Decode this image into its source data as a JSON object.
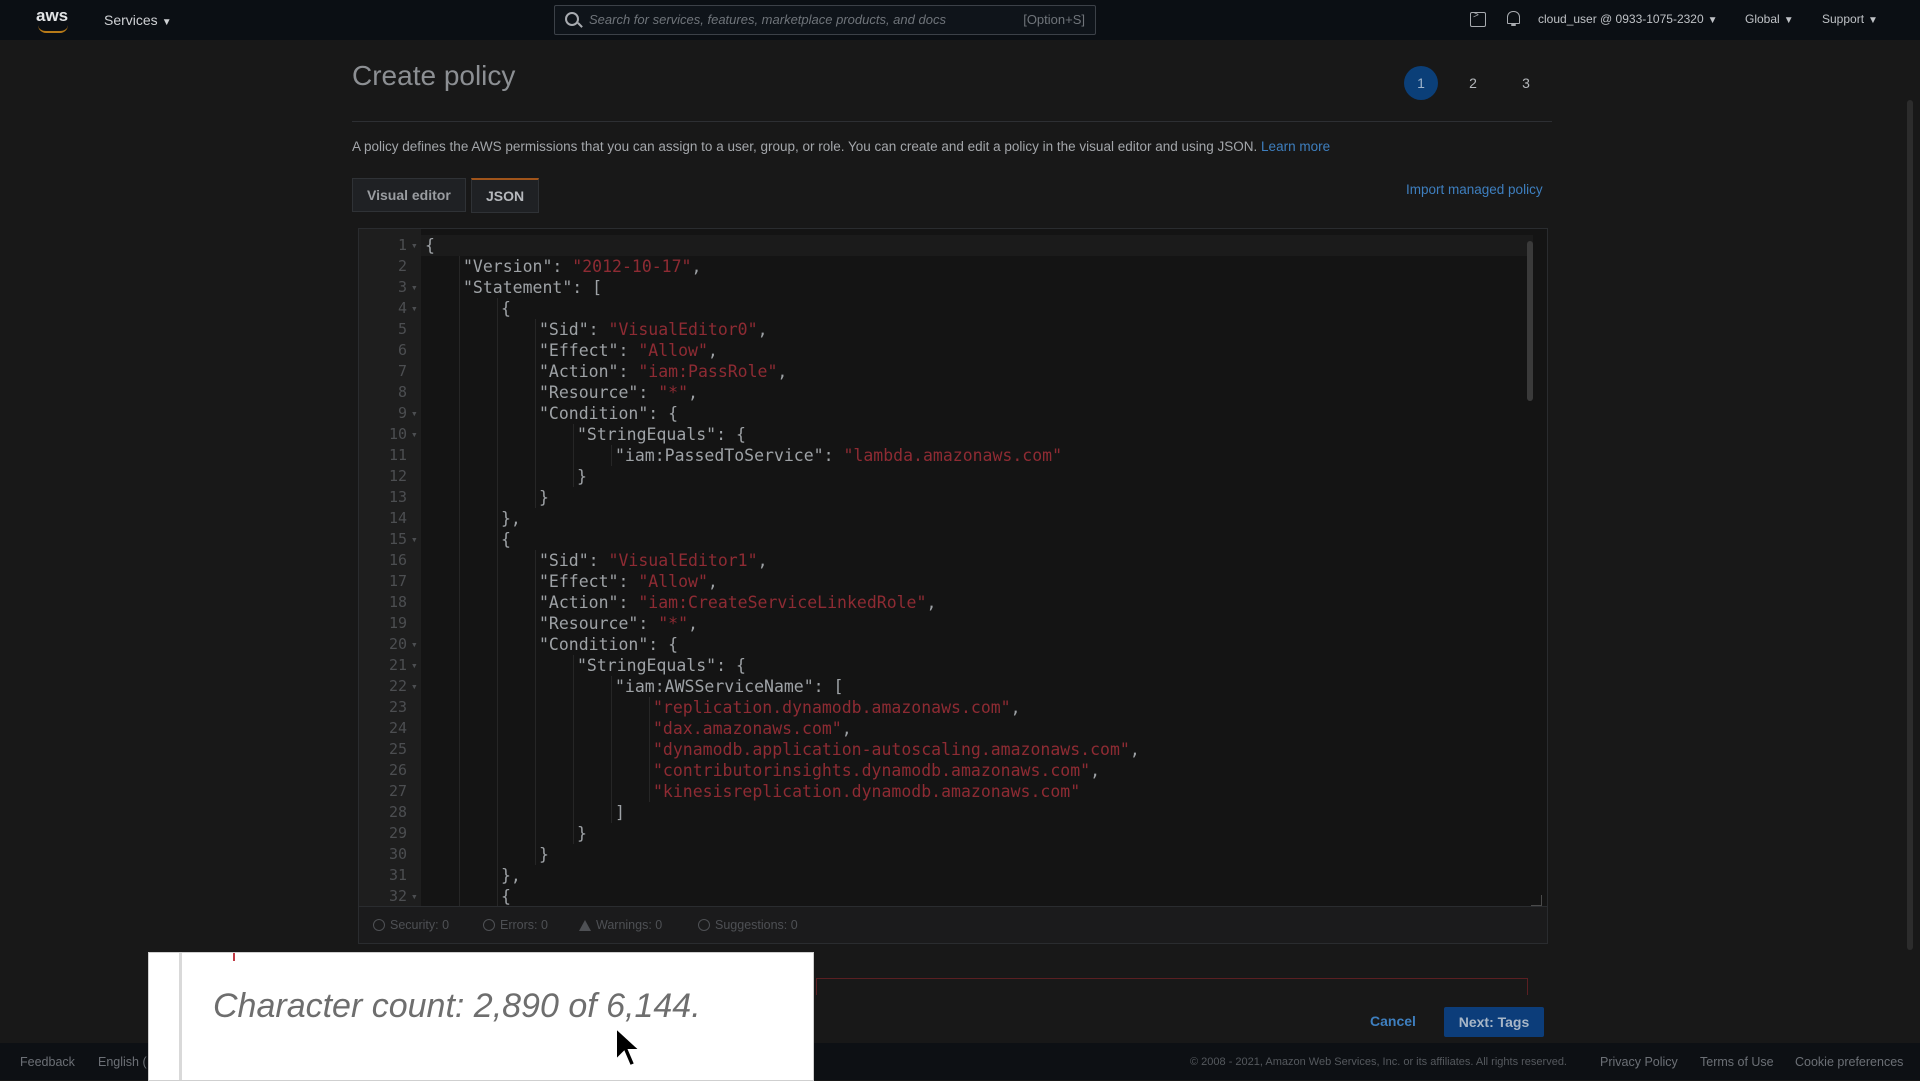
{
  "topnav": {
    "logo": "aws",
    "services_label": "Services",
    "search_placeholder": "Search for services, features, marketplace products, and docs",
    "search_shortcut": "[Option+S]",
    "account": "cloud_user @ 0933-1075-2320",
    "region": "Global",
    "support": "Support"
  },
  "page": {
    "title": "Create policy",
    "steps": [
      "1",
      "2",
      "3"
    ],
    "description": "A policy defines the AWS permissions that you can assign to a user, group, or role. You can create and edit a policy in the visual editor and using JSON.",
    "learn_more": "Learn more",
    "tabs": [
      "Visual editor",
      "JSON"
    ],
    "active_tab": "JSON",
    "import_link": "Import managed policy"
  },
  "editor": {
    "lines": [
      {
        "n": "1",
        "fold": true,
        "indent": 0,
        "parts": [
          [
            "p",
            "{"
          ]
        ]
      },
      {
        "n": "2",
        "fold": false,
        "indent": 1,
        "parts": [
          [
            "p",
            "\"Version\": "
          ],
          [
            "s",
            "\"2012-10-17\""
          ],
          [
            "p",
            ","
          ]
        ]
      },
      {
        "n": "3",
        "fold": true,
        "indent": 1,
        "parts": [
          [
            "p",
            "\"Statement\": ["
          ]
        ]
      },
      {
        "n": "4",
        "fold": true,
        "indent": 2,
        "parts": [
          [
            "p",
            "{"
          ]
        ]
      },
      {
        "n": "5",
        "fold": false,
        "indent": 3,
        "parts": [
          [
            "p",
            "\"Sid\": "
          ],
          [
            "s",
            "\"VisualEditor0\""
          ],
          [
            "p",
            ","
          ]
        ]
      },
      {
        "n": "6",
        "fold": false,
        "indent": 3,
        "parts": [
          [
            "p",
            "\"Effect\": "
          ],
          [
            "s",
            "\"Allow\""
          ],
          [
            "p",
            ","
          ]
        ]
      },
      {
        "n": "7",
        "fold": false,
        "indent": 3,
        "parts": [
          [
            "p",
            "\"Action\": "
          ],
          [
            "s",
            "\"iam:PassRole\""
          ],
          [
            "p",
            ","
          ]
        ]
      },
      {
        "n": "8",
        "fold": false,
        "indent": 3,
        "parts": [
          [
            "p",
            "\"Resource\": "
          ],
          [
            "s",
            "\"*\""
          ],
          [
            "p",
            ","
          ]
        ]
      },
      {
        "n": "9",
        "fold": true,
        "indent": 3,
        "parts": [
          [
            "p",
            "\"Condition\": {"
          ]
        ]
      },
      {
        "n": "10",
        "fold": true,
        "indent": 4,
        "parts": [
          [
            "p",
            "\"StringEquals\": {"
          ]
        ]
      },
      {
        "n": "11",
        "fold": false,
        "indent": 5,
        "parts": [
          [
            "p",
            "\"iam:PassedToService\": "
          ],
          [
            "s",
            "\"lambda.amazonaws.com\""
          ]
        ]
      },
      {
        "n": "12",
        "fold": false,
        "indent": 4,
        "parts": [
          [
            "p",
            "}"
          ]
        ]
      },
      {
        "n": "13",
        "fold": false,
        "indent": 3,
        "parts": [
          [
            "p",
            "}"
          ]
        ]
      },
      {
        "n": "14",
        "fold": false,
        "indent": 2,
        "parts": [
          [
            "p",
            "},"
          ]
        ]
      },
      {
        "n": "15",
        "fold": true,
        "indent": 2,
        "parts": [
          [
            "p",
            "{"
          ]
        ]
      },
      {
        "n": "16",
        "fold": false,
        "indent": 3,
        "parts": [
          [
            "p",
            "\"Sid\": "
          ],
          [
            "s",
            "\"VisualEditor1\""
          ],
          [
            "p",
            ","
          ]
        ]
      },
      {
        "n": "17",
        "fold": false,
        "indent": 3,
        "parts": [
          [
            "p",
            "\"Effect\": "
          ],
          [
            "s",
            "\"Allow\""
          ],
          [
            "p",
            ","
          ]
        ]
      },
      {
        "n": "18",
        "fold": false,
        "indent": 3,
        "parts": [
          [
            "p",
            "\"Action\": "
          ],
          [
            "s",
            "\"iam:CreateServiceLinkedRole\""
          ],
          [
            "p",
            ","
          ]
        ]
      },
      {
        "n": "19",
        "fold": false,
        "indent": 3,
        "parts": [
          [
            "p",
            "\"Resource\": "
          ],
          [
            "s",
            "\"*\""
          ],
          [
            "p",
            ","
          ]
        ]
      },
      {
        "n": "20",
        "fold": true,
        "indent": 3,
        "parts": [
          [
            "p",
            "\"Condition\": {"
          ]
        ]
      },
      {
        "n": "21",
        "fold": true,
        "indent": 4,
        "parts": [
          [
            "p",
            "\"StringEquals\": {"
          ]
        ]
      },
      {
        "n": "22",
        "fold": true,
        "indent": 5,
        "parts": [
          [
            "p",
            "\"iam:AWSServiceName\": ["
          ]
        ]
      },
      {
        "n": "23",
        "fold": false,
        "indent": 6,
        "parts": [
          [
            "s",
            "\"replication.dynamodb.amazonaws.com\""
          ],
          [
            "p",
            ","
          ]
        ]
      },
      {
        "n": "24",
        "fold": false,
        "indent": 6,
        "parts": [
          [
            "s",
            "\"dax.amazonaws.com\""
          ],
          [
            "p",
            ","
          ]
        ]
      },
      {
        "n": "25",
        "fold": false,
        "indent": 6,
        "parts": [
          [
            "s",
            "\"dynamodb.application-autoscaling.amazonaws.com\""
          ],
          [
            "p",
            ","
          ]
        ]
      },
      {
        "n": "26",
        "fold": false,
        "indent": 6,
        "parts": [
          [
            "s",
            "\"contributorinsights.dynamodb.amazonaws.com\""
          ],
          [
            "p",
            ","
          ]
        ]
      },
      {
        "n": "27",
        "fold": false,
        "indent": 6,
        "parts": [
          [
            "s",
            "\"kinesisreplication.dynamodb.amazonaws.com\""
          ]
        ]
      },
      {
        "n": "28",
        "fold": false,
        "indent": 5,
        "parts": [
          [
            "p",
            "]"
          ]
        ]
      },
      {
        "n": "29",
        "fold": false,
        "indent": 4,
        "parts": [
          [
            "p",
            "}"
          ]
        ]
      },
      {
        "n": "30",
        "fold": false,
        "indent": 3,
        "parts": [
          [
            "p",
            "}"
          ]
        ]
      },
      {
        "n": "31",
        "fold": false,
        "indent": 2,
        "parts": [
          [
            "p",
            "},"
          ]
        ]
      },
      {
        "n": "32",
        "fold": true,
        "indent": 2,
        "parts": [
          [
            "p",
            "{"
          ]
        ]
      }
    ],
    "status": {
      "security": "Security: 0",
      "errors": "Errors: 0",
      "warnings": "Warnings: 0",
      "suggestions": "Suggestions: 0"
    }
  },
  "actions": {
    "cancel": "Cancel",
    "next": "Next: Tags"
  },
  "footer": {
    "feedback": "Feedback",
    "language": "English (",
    "copyright": "© 2008 - 2021, Amazon Web Services, Inc. or its affiliates. All rights reserved.",
    "privacy": "Privacy Policy",
    "terms": "Terms of Use",
    "cookies": "Cookie preferences"
  },
  "tooltip": {
    "text": "Character count: 2,890 of 6,144."
  }
}
